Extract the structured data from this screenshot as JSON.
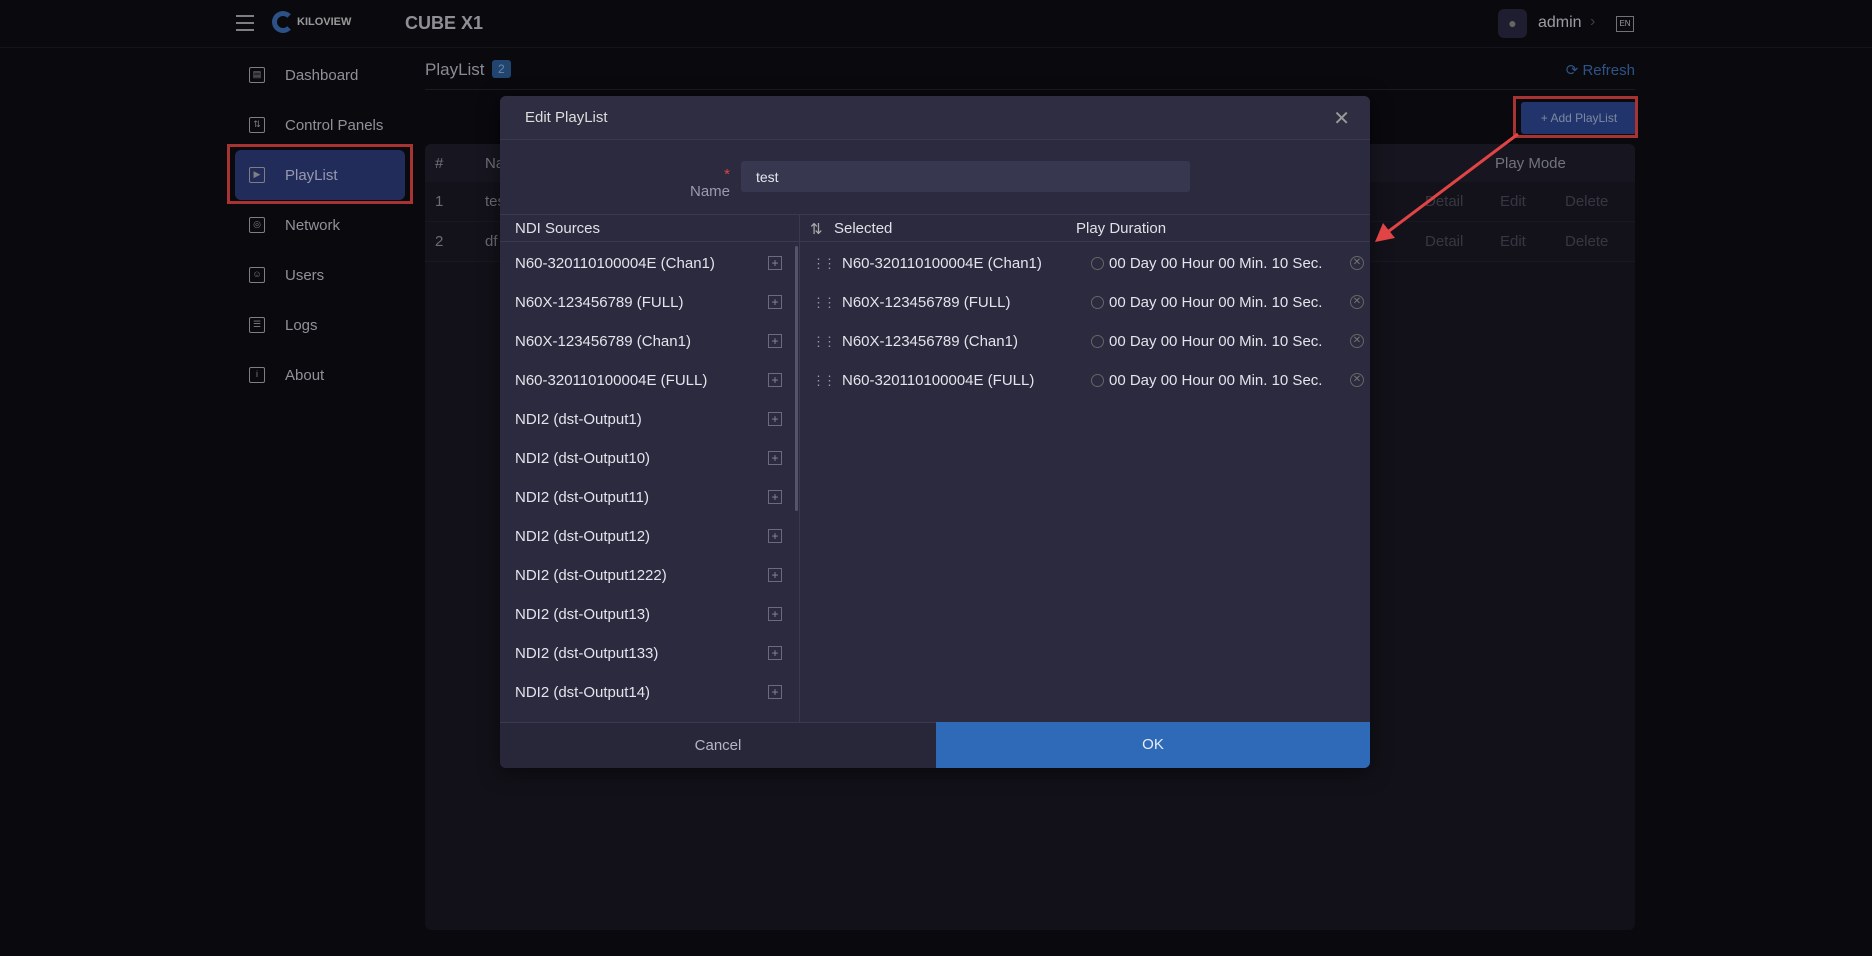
{
  "header": {
    "brand": "KILOVIEW",
    "product": "CUBE X1",
    "user": "admin",
    "lang": "EN"
  },
  "sidebar": {
    "items": [
      {
        "label": "Dashboard",
        "icon": "dashboard-icon"
      },
      {
        "label": "Control Panels",
        "icon": "sliders-icon"
      },
      {
        "label": "PlayList",
        "icon": "play-icon",
        "active": true
      },
      {
        "label": "Network",
        "icon": "globe-icon"
      },
      {
        "label": "Users",
        "icon": "user-icon"
      },
      {
        "label": "Logs",
        "icon": "log-icon"
      },
      {
        "label": "About",
        "icon": "info-icon"
      }
    ]
  },
  "main": {
    "title": "PlayList",
    "count": "2",
    "refresh": "Refresh",
    "add_button": "+ Add PlayList",
    "table": {
      "headers": [
        "#",
        "Name",
        "Play Mode"
      ],
      "rows": [
        {
          "n": "1",
          "name": "test"
        },
        {
          "n": "2",
          "name": "df"
        }
      ],
      "actions": [
        "Detail",
        "Edit",
        "Delete"
      ]
    }
  },
  "modal": {
    "title": "Edit PlayList",
    "name_label": "Name",
    "name_value": "test",
    "col_sources": "NDI Sources",
    "col_selected": "Selected",
    "col_duration": "Play Duration",
    "sources": [
      "N60-320110100004E (Chan1)",
      "N60X-123456789 (FULL)",
      "N60X-123456789 (Chan1)",
      "N60-320110100004E (FULL)",
      "NDI2 (dst-Output1)",
      "NDI2 (dst-Output10)",
      "NDI2 (dst-Output11)",
      "NDI2 (dst-Output12)",
      "NDI2 (dst-Output1222)",
      "NDI2 (dst-Output13)",
      "NDI2 (dst-Output133)",
      "NDI2 (dst-Output14)"
    ],
    "selected": [
      {
        "name": "N60-320110100004E (Chan1)",
        "duration": "00 Day 00 Hour 00 Min. 10 Sec."
      },
      {
        "name": "N60X-123456789 (FULL)",
        "duration": "00 Day 00 Hour 00 Min. 10 Sec."
      },
      {
        "name": "N60X-123456789 (Chan1)",
        "duration": "00 Day 00 Hour 00 Min. 10 Sec."
      },
      {
        "name": "N60-320110100004E (FULL)",
        "duration": "00 Day 00 Hour 00 Min. 10 Sec."
      }
    ],
    "cancel": "Cancel",
    "ok": "OK"
  },
  "colors": {
    "accent": "#2f6ab8",
    "highlight": "#e04444",
    "active_nav": "#2c3b7a"
  }
}
